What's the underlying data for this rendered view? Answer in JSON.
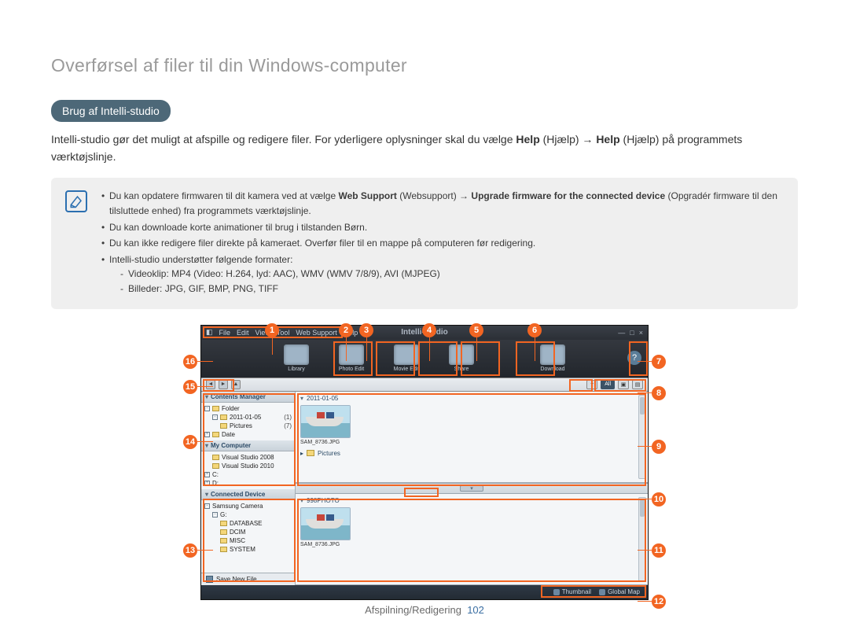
{
  "page_title": "Overførsel af filer til din Windows-computer",
  "section_pill": "Brug af Intelli-studio",
  "intro": {
    "pre": "Intelli-studio gør det muligt at afspille og redigere filer. For yderligere oplysninger skal du vælge ",
    "help1": "Help",
    "help1_paren": " (Hjælp) → ",
    "help2": "Help",
    "help2_paren": " (Hjælp) på programmets værktøjslinje."
  },
  "notes": {
    "n1_pre": "Du kan opdatere firmwaren til dit kamera ved at vælge ",
    "n1_b1": "Web Support",
    "n1_mid": " (Websupport) → ",
    "n1_b2": "Upgrade firmware for the connected device",
    "n1_post": " (Opgradér firmware til den tilsluttede enhed) fra programmets værktøjslinje.",
    "n2": "Du kan downloade korte animationer til brug i tilstanden Børn.",
    "n3": "Du kan ikke redigere filer direkte på kameraet. Overfør filer til en mappe på computeren før redigering.",
    "n4": "Intelli-studio understøtter følgende formater:",
    "n4a": "Videoklip: MP4 (Video: H.264, lyd: AAC), WMV (WMV 7/8/9), AVI (MJPEG)",
    "n4b": "Billeder: JPG, GIF, BMP, PNG, TIFF"
  },
  "callouts": [
    "1",
    "2",
    "3",
    "4",
    "5",
    "6",
    "7",
    "8",
    "9",
    "10",
    "11",
    "12",
    "13",
    "14",
    "15",
    "16"
  ],
  "app": {
    "brand": "Intelli-studio",
    "menu": [
      "File",
      "Edit",
      "View",
      "Tool",
      "Web Support",
      "Help"
    ],
    "winctrl": [
      "—",
      "□",
      "×"
    ],
    "toolbar": [
      {
        "label": "Library"
      },
      {
        "label": "Photo Edit"
      },
      {
        "label": "Movie Edit"
      },
      {
        "label": "Share"
      },
      {
        "label": "Download"
      }
    ],
    "path_filter_all": "All",
    "sidebar": {
      "contents": {
        "title": "Contents Manager",
        "folder_root": "Folder",
        "folder_date": "2011-01-05",
        "folder_date_count": "(1)",
        "folder_pictures": "Pictures",
        "folder_pictures_count": "(7)",
        "date_root": "Date"
      },
      "computer": {
        "title": "My Computer",
        "vs2008": "Visual Studio 2008",
        "vs2010": "Visual Studio 2010",
        "drive_c": "C:",
        "drive_d": "D:"
      },
      "device": {
        "title": "Connected Device",
        "camera": "Samsung Camera",
        "drive": "G:",
        "d1": "DATABASE",
        "d2": "DCIM",
        "d3": "MISC",
        "d4": "SYSTEM"
      },
      "save": "Save New File"
    },
    "panes": {
      "top_head": "2011-01-05",
      "top_file": "SAM_8736.JPG",
      "top_folder": "Pictures",
      "bot_head": "998PHOTO",
      "bot_file": "SAM_8736.JPG"
    },
    "footer": {
      "thumb": "Thumbnail",
      "map": "Global Map"
    }
  },
  "footer": {
    "section": "Afspilning/Redigering",
    "page": "102"
  }
}
